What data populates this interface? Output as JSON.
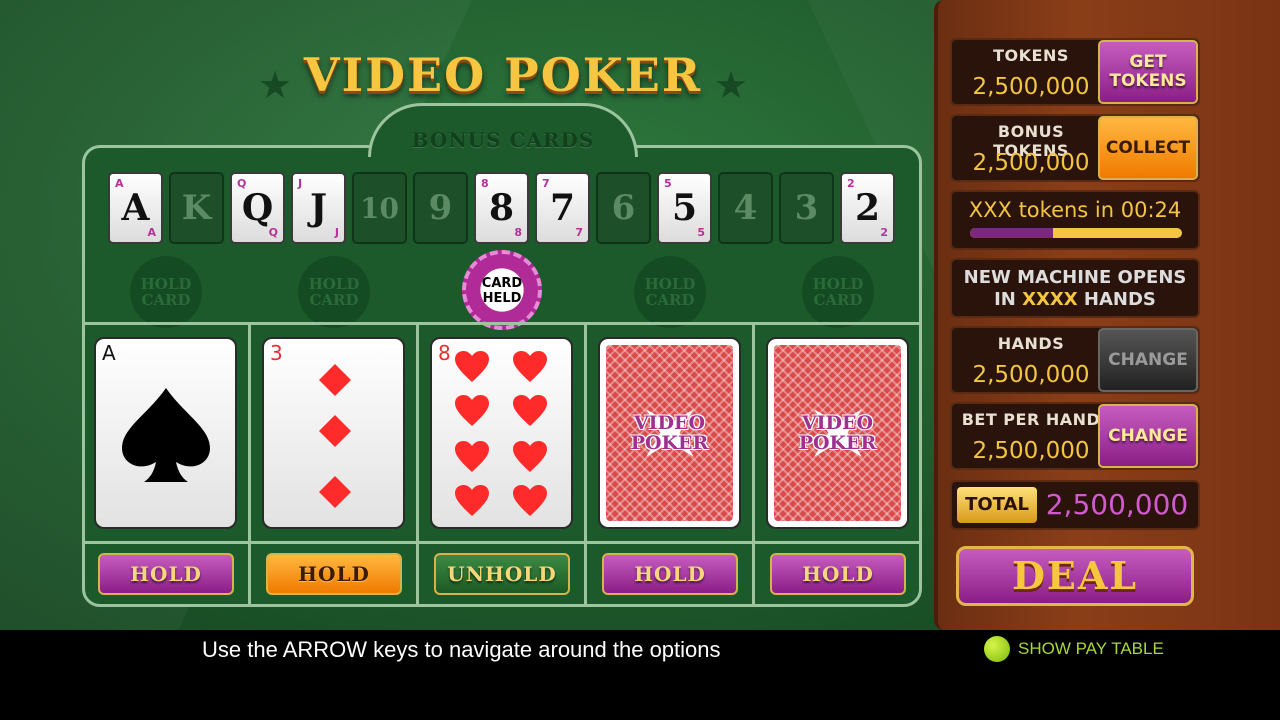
{
  "title": "VIDEO POKER",
  "bonus_cards": {
    "label": "BONUS CARDS",
    "cards": [
      {
        "rank": "A",
        "active": true
      },
      {
        "rank": "K",
        "active": false
      },
      {
        "rank": "Q",
        "active": true
      },
      {
        "rank": "J",
        "active": true
      },
      {
        "rank": "10",
        "active": false
      },
      {
        "rank": "9",
        "active": false
      },
      {
        "rank": "8",
        "active": true
      },
      {
        "rank": "7",
        "active": true
      },
      {
        "rank": "6",
        "active": false
      },
      {
        "rank": "5",
        "active": true
      },
      {
        "rank": "4",
        "active": false
      },
      {
        "rank": "3",
        "active": false
      },
      {
        "rank": "2",
        "active": true
      }
    ]
  },
  "hold_placeholder_label": "HOLD CARD",
  "card_held_label": "CARD HELD",
  "hand": [
    {
      "rank": "A",
      "suit": "spades",
      "face_up": true,
      "button": "HOLD",
      "button_style": "purple"
    },
    {
      "rank": "3",
      "suit": "diamonds",
      "face_up": true,
      "button": "HOLD",
      "button_style": "orange"
    },
    {
      "rank": "8",
      "suit": "hearts",
      "face_up": true,
      "button": "UNHOLD",
      "button_style": "green"
    },
    {
      "rank": "",
      "suit": "",
      "face_up": false,
      "back_text": "VIDEO POKER",
      "button": "HOLD",
      "button_style": "purple"
    },
    {
      "rank": "",
      "suit": "",
      "face_up": false,
      "back_text": "VIDEO POKER",
      "button": "HOLD",
      "button_style": "purple"
    }
  ],
  "side": {
    "tokens": {
      "label": "TOKENS",
      "value": "2,500,000",
      "button": "GET TOKENS"
    },
    "bonus_tokens": {
      "label": "BONUS TOKENS",
      "value": "2,500,000",
      "button": "COLLECT"
    },
    "timer": {
      "text": "XXX tokens in 00:24",
      "progress": 0.39
    },
    "new_machine": {
      "line1": "NEW MACHINE OPENS",
      "line2_prefix": "IN ",
      "line2_highlight": "XXXX",
      "line2_suffix": " HANDS"
    },
    "hands": {
      "label": "HANDS",
      "value": "2,500,000",
      "button": "CHANGE"
    },
    "bet_per_hand": {
      "label": "BET PER HAND",
      "value": "2,500,000",
      "button": "CHANGE"
    },
    "total": {
      "label": "TOTAL",
      "value": "2,500,000"
    },
    "deal": "DEAL"
  },
  "footer": {
    "instruction": "Use the ARROW keys to navigate around the options",
    "paytable": "SHOW PAY TABLE"
  },
  "colors": {
    "felt": "#1f5a2c",
    "gold": "#f3c540",
    "purple": "#8b1e86",
    "orange": "#f07a00",
    "wood": "#7a3414"
  }
}
